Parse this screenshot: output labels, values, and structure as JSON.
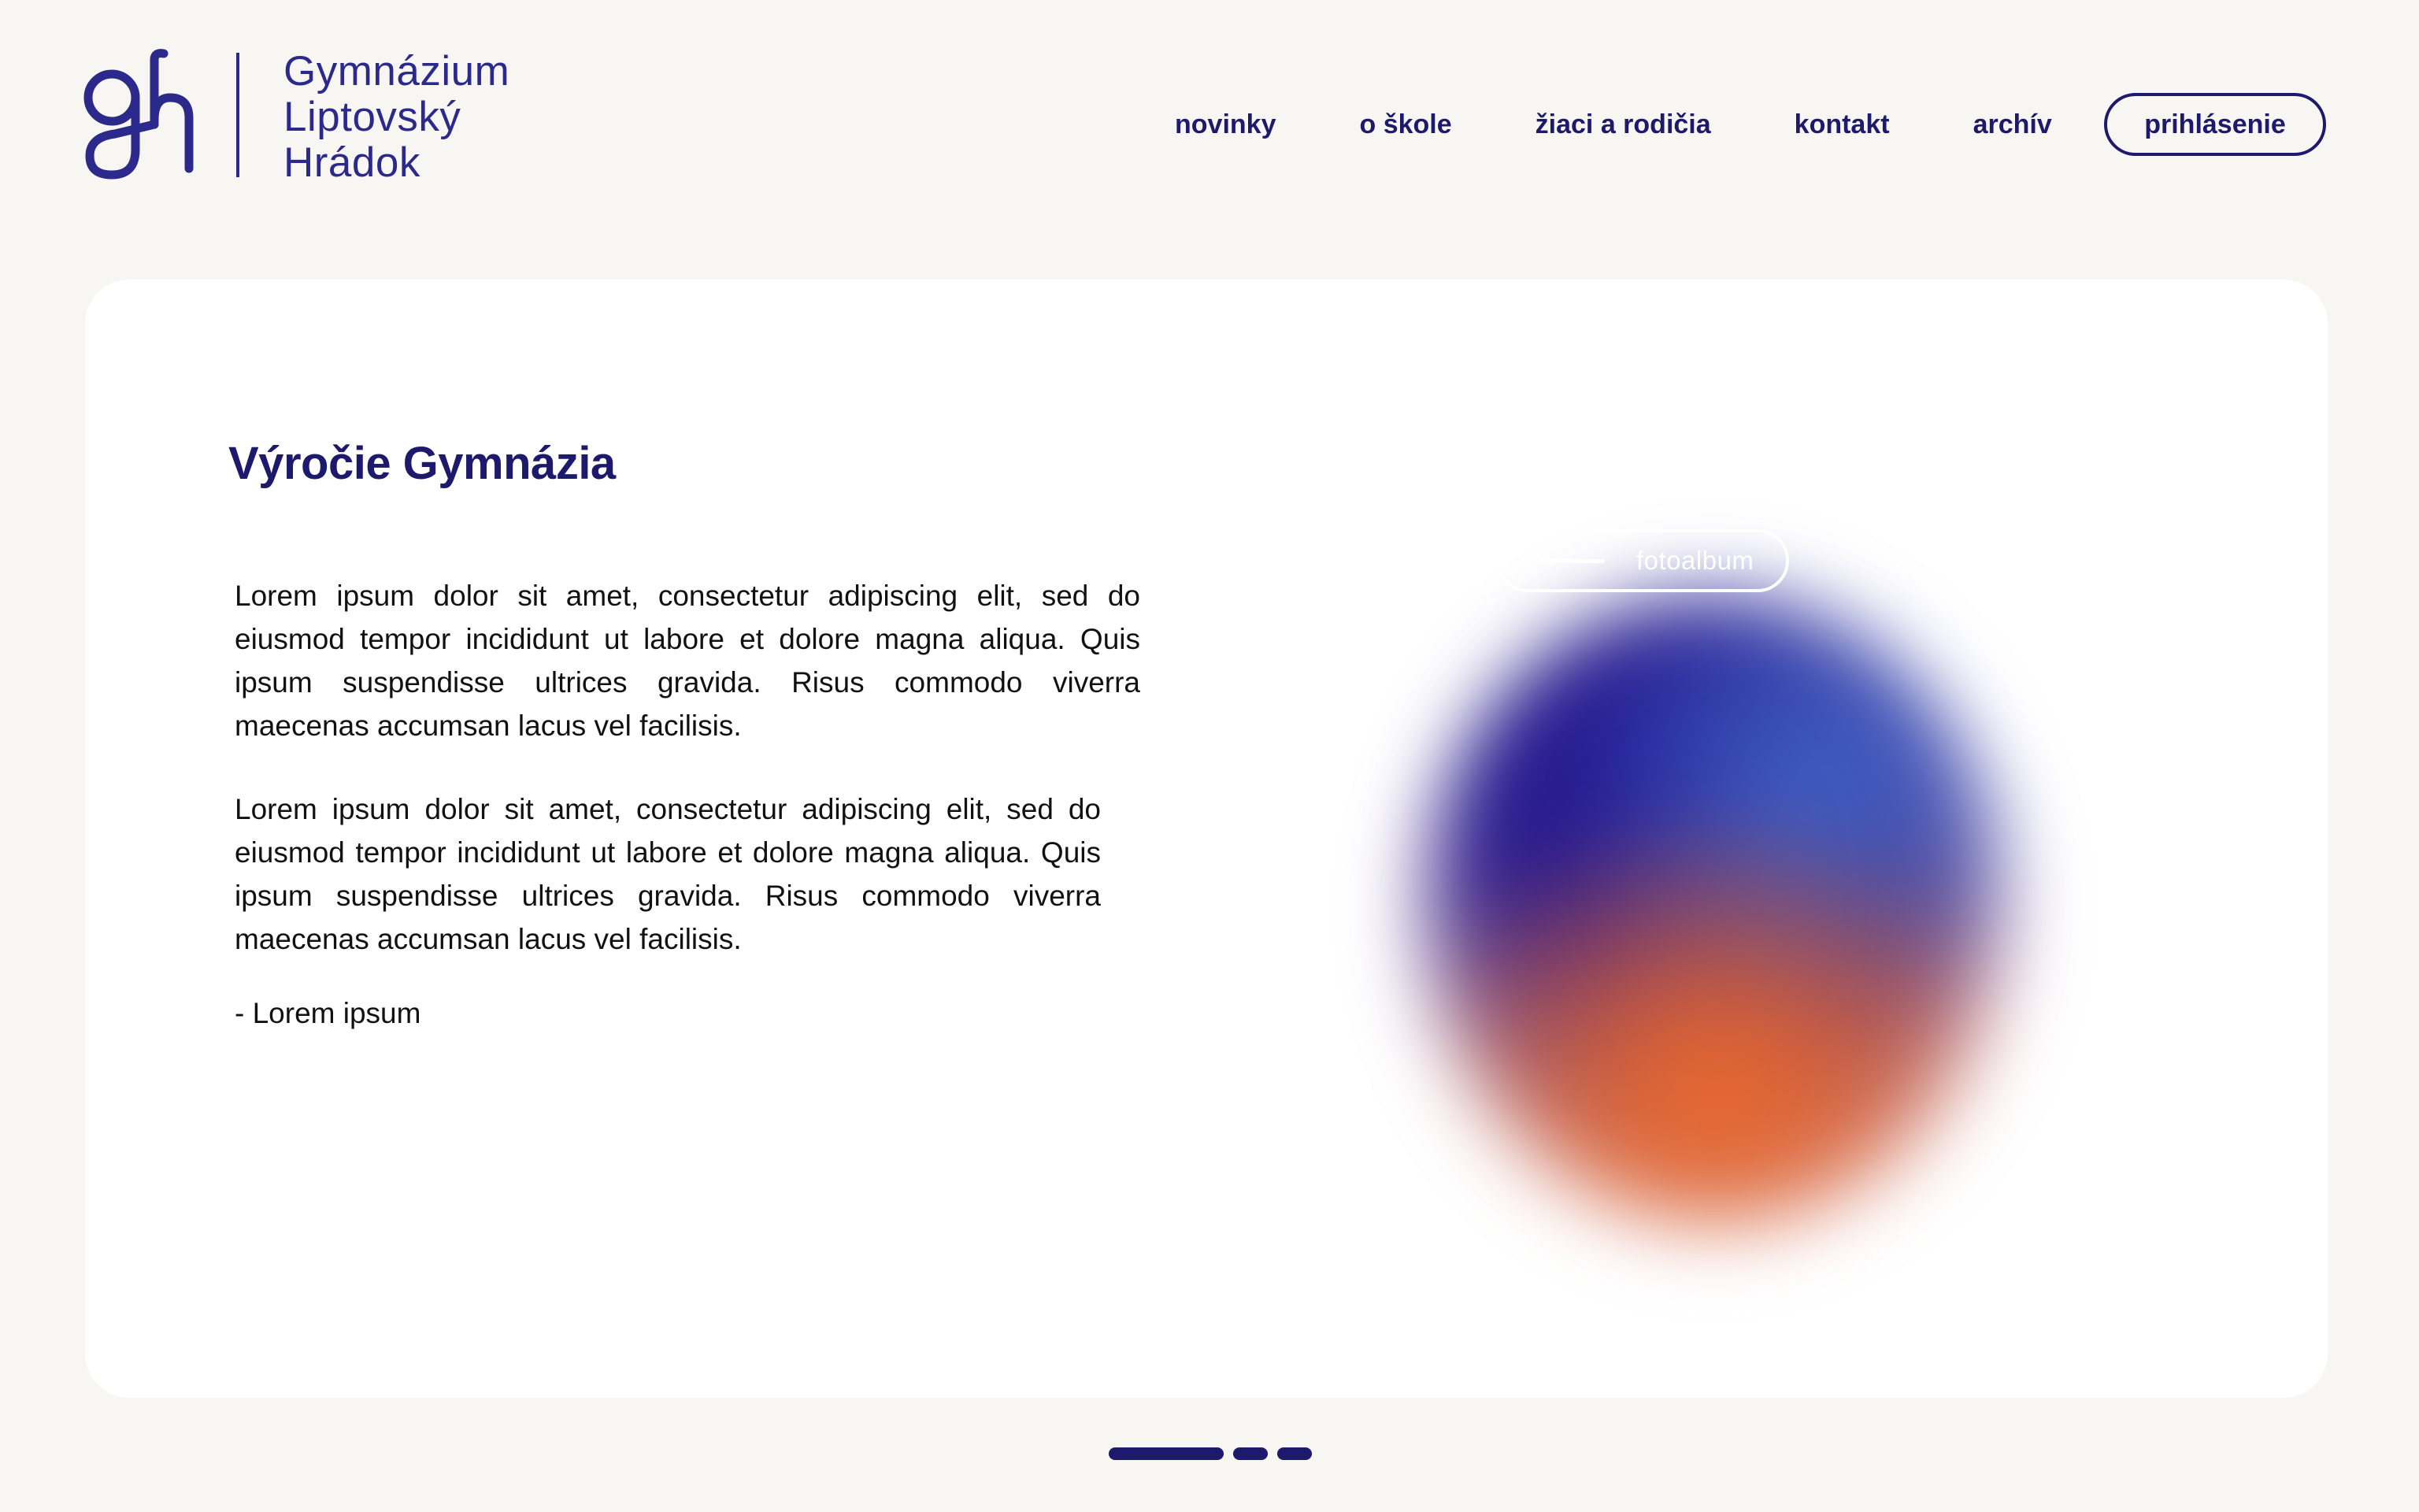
{
  "logo": {
    "name_lines": [
      "Gymnázium",
      "Liptovský",
      "Hrádok"
    ],
    "icon": "gh-monogram-icon"
  },
  "nav": {
    "items": [
      {
        "label": "novinky"
      },
      {
        "label": "o škole"
      },
      {
        "label": "žiaci a rodičia"
      },
      {
        "label": "kontakt"
      },
      {
        "label": "archív"
      }
    ],
    "login_label": "prihlásenie"
  },
  "card": {
    "title": "Výročie Gymnázia",
    "paragraphs": [
      "Lorem ipsum dolor sit amet, consectetur adipiscing elit, sed do eiusmod tempor incididunt ut labore et dolore magna aliqua. Quis ipsum suspendisse ultrices gravida. Risus commodo viverra maecenas accumsan lacus vel facilisis.",
      "Lorem ipsum dolor sit amet, consectetur adipiscing elit, sed do eiusmod tempor incididunt ut labore et dolore magna aliqua. Quis ipsum suspendisse ultrices gravida. Risus commodo viverra maecenas accumsan lacus vel facilisis."
    ],
    "signature": "- Lorem ipsum",
    "gallery_button_label": "fotoalbum"
  },
  "pagination": {
    "pages": 3,
    "active_index": 0
  },
  "colors": {
    "background": "#f8f6f2",
    "brand": "#2b2a8c",
    "nav_text": "#1d1a6e",
    "card": "#ffffff",
    "orb_orange": "#ef6a2a",
    "orb_indigo": "#1c1290"
  }
}
